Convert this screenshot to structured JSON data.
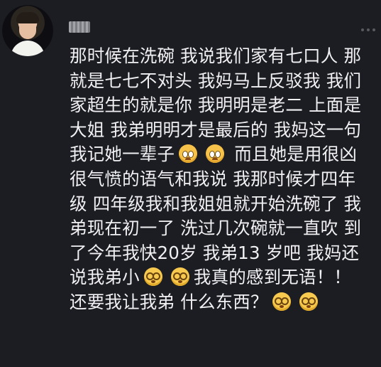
{
  "post": {
    "lines": [
      "那时候在洗碗 我说我们家有七口人 那",
      "就是七七不对头 我妈马上反驳我 我们",
      "家超生的就是你 我明明是老二 上面是",
      "大姐 我弟明明才是最后的 我妈这一句",
      "我记她一辈子",
      "而且她是用很凶",
      "很气愤的语气和我说 我那时候才四年",
      "级 四年级我和我姐姐就开始洗碗了 我",
      "弟现在初一了 洗过几次碗就一直吹 到",
      "了今年我快20岁 我弟13 岁吧 我妈还",
      "说我弟小",
      "我真的感到无语！！",
      "还要我让我弟 什么东西？"
    ],
    "emoji": {
      "cry": "crying-face-emoji",
      "dazed": "dazed-face-emoji"
    }
  }
}
